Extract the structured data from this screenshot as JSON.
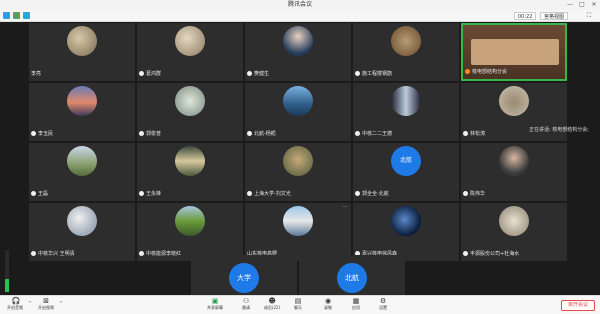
{
  "window": {
    "title": "腾讯会议",
    "minimize": "—",
    "maximize": "□",
    "close": "✕"
  },
  "topbar": {
    "time": "00:22",
    "view_label": "宫格视图",
    "speaking_text": "正在讲话: 核电部结构分会;"
  },
  "participants": [
    {
      "name": "李亮",
      "mic": false,
      "avatar": "lake-scenery"
    },
    {
      "name": "葛鸿群",
      "mic": true,
      "avatar": "landscape-photo"
    },
    {
      "name": "樊健生",
      "mic": true,
      "avatar": "portrait-photo"
    },
    {
      "name": "施工程楼钢筋",
      "mic": true,
      "avatar": "calligraphy-photo"
    },
    {
      "name": "核电部结构分会",
      "mic": true,
      "mic_color": "#ff8a1e",
      "avatar": "meeting-room-video"
    },
    {
      "name": "李玉民",
      "mic": true,
      "avatar": "sunset-photo"
    },
    {
      "name": "郭俊普",
      "mic": true,
      "avatar": "flower-photo"
    },
    {
      "name": "北航-杨栀",
      "mic": true,
      "avatar": "lake-photo"
    },
    {
      "name": "中核二二王德",
      "mic": true,
      "avatar": "tower-photo"
    },
    {
      "name": "林松涛",
      "mic": true,
      "avatar": "animal-photo"
    },
    {
      "name": "王磊",
      "mic": true,
      "avatar": "mountain-photo"
    },
    {
      "name": "王永锋",
      "mic": true,
      "avatar": "road-photo"
    },
    {
      "name": "上海大学-刘文光",
      "mic": true,
      "avatar": "dog-photo"
    },
    {
      "name": "郭全全-北航",
      "mic": true,
      "avatar_text": "北航"
    },
    {
      "name": "陈伟华",
      "mic": true,
      "avatar": "man-photo"
    },
    {
      "name": "中核华兴 王明清",
      "mic": true,
      "avatar": "clouds-photo"
    },
    {
      "name": "中核能源李晓红",
      "mic": true,
      "avatar": "field-photo"
    },
    {
      "name": "山东核电高野",
      "mic": false,
      "avatar": "bridge-photo",
      "more": "···"
    },
    {
      "name": "嘉兴核电徐风森",
      "mic": true,
      "avatar": "earth-photo"
    },
    {
      "name": "丰源股份公司+杜海水",
      "mic": true,
      "avatar": "car-photo"
    }
  ],
  "bottom_tiles": [
    {
      "avatar_text": "大学"
    },
    {
      "avatar_text": "北航"
    }
  ],
  "volume_level": 0.3,
  "toolbar": {
    "mute_label": "开启音频",
    "video_label": "开启视频",
    "share_label": "共享屏幕",
    "invite_label": "邀请",
    "members_label": "成员(22)",
    "chat_label": "聊天",
    "record_label": "录制",
    "apps_label": "应用",
    "settings_label": "设置",
    "end_label": "离开会议"
  }
}
